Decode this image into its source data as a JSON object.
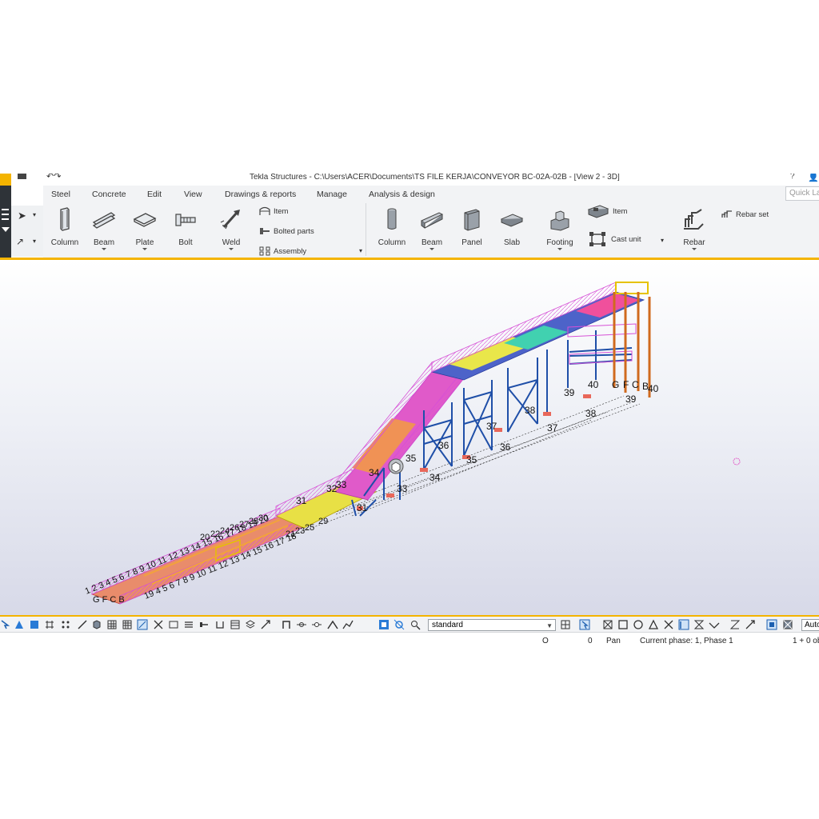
{
  "window": {
    "title": "Tekla Structures - C:\\Users\\ACER\\Documents\\TS FILE KERJA\\CONVEYOR BC-02A-02B  - [View 2 - 3D]",
    "help": "?",
    "user_icon": "user-icon"
  },
  "tabs": [
    {
      "label": "Steel",
      "active": true
    },
    {
      "label": "Concrete",
      "active": false
    },
    {
      "label": "Edit",
      "active": false
    },
    {
      "label": "View",
      "active": false
    },
    {
      "label": "Drawings & reports",
      "active": false
    },
    {
      "label": "Manage",
      "active": false
    },
    {
      "label": "Analysis & design",
      "active": false
    }
  ],
  "quick_launch": {
    "placeholder": "Quick Launch"
  },
  "steel": {
    "column": "Column",
    "beam": "Beam",
    "plate": "Plate",
    "bolt": "Bolt",
    "weld": "Weld",
    "item": "Item",
    "bolted_parts": "Bolted parts",
    "assembly": "Assembly"
  },
  "concrete": {
    "column": "Column",
    "beam": "Beam",
    "panel": "Panel",
    "slab": "Slab",
    "footing": "Footing",
    "item": "Item",
    "cast_unit": "Cast unit",
    "rebar": "Rebar",
    "rebar_set": "Rebar set"
  },
  "view": {
    "grid_labels_right": [
      "G",
      "F",
      "C",
      "B",
      "40",
      "40",
      "39",
      "39"
    ],
    "grid_labels_mid": [
      "38",
      "38",
      "37",
      "37",
      "36",
      "36",
      "35",
      "35",
      "34",
      "34",
      "33",
      "33",
      "32",
      "31",
      "31"
    ],
    "grid_labels_low": [
      "30",
      "29",
      "28",
      "27",
      "26",
      "25",
      "24",
      "23",
      "22",
      "21",
      "20"
    ],
    "grid_labels_left": [
      "1 2 3 4 5 6 7 8 9 10 11 12 13 14 15 16 17 18 19 20",
      "G F C B",
      "19 4 5 6 7 8 9 10 11 12 13 14 15 16 17 18"
    ]
  },
  "toolbar": {
    "filter": "standard",
    "auto": "Auto"
  },
  "status": {
    "o_label": "O",
    "o_value": "0",
    "mode": "Pan",
    "phase": "Current phase: 1, Phase 1",
    "selection": "1 + 0 ob"
  },
  "colors": {
    "accent": "#f4b400",
    "steel_blue": "#1f4fa8",
    "handrail_magenta": "#e04ad8",
    "column_orange": "#d06a1e"
  }
}
